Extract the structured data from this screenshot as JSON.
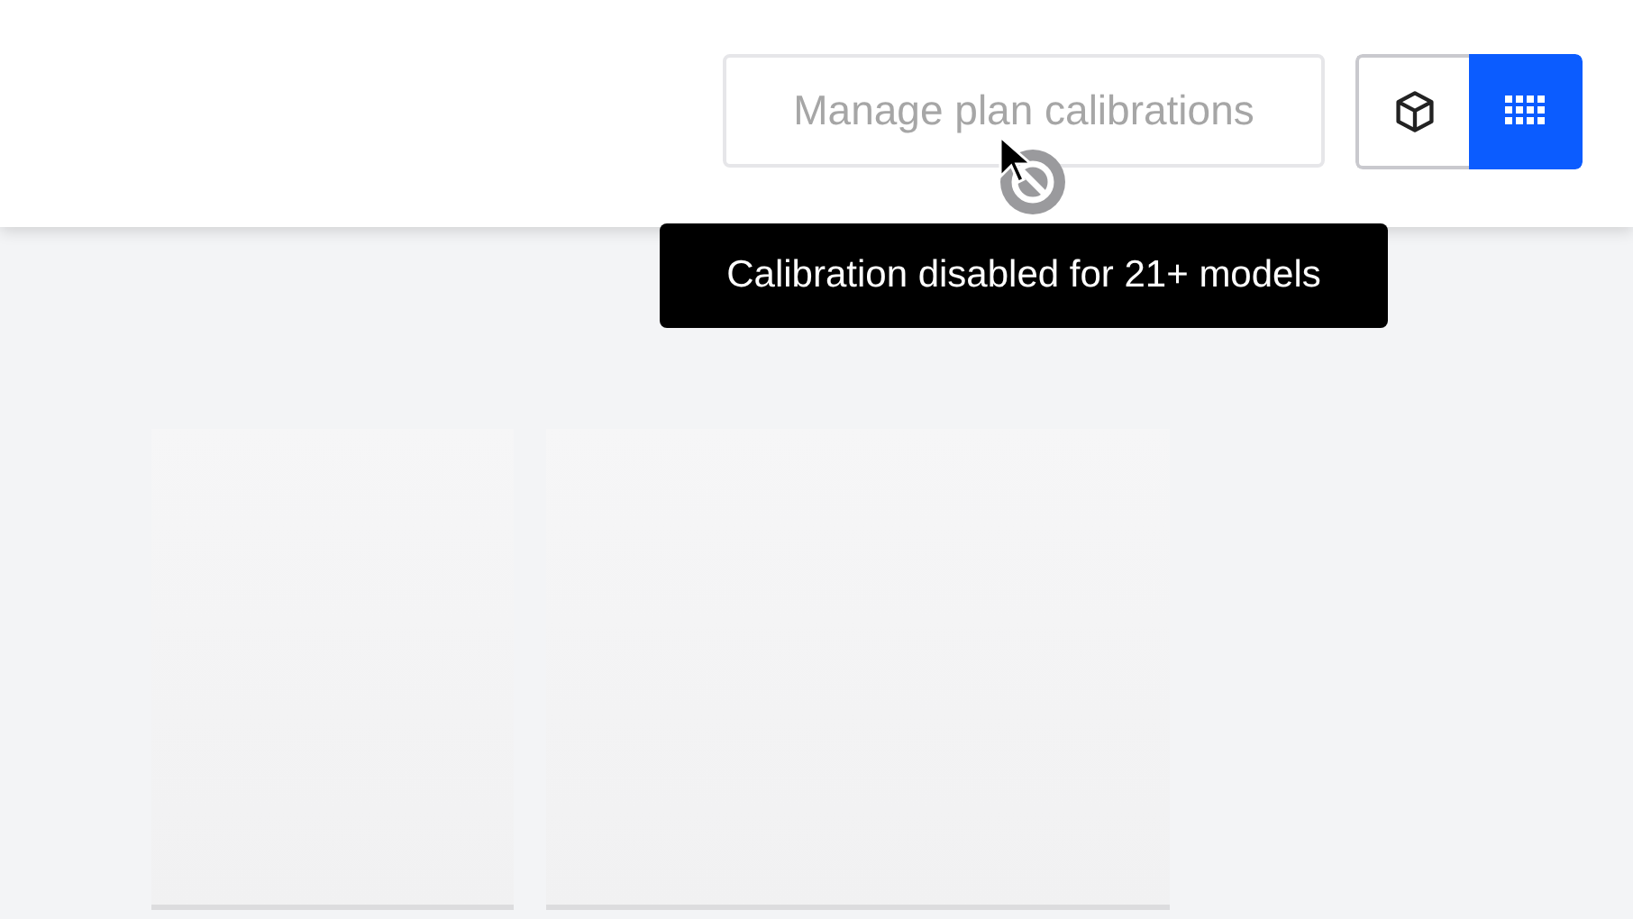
{
  "manage_button": {
    "label": "Manage plan calibrations",
    "disabled": true
  },
  "view_toggle": [
    {
      "kind": "cube",
      "selected": false
    },
    {
      "kind": "grid",
      "selected": true
    }
  ],
  "tooltip": {
    "text": "Calibration disabled for 21+ models"
  }
}
